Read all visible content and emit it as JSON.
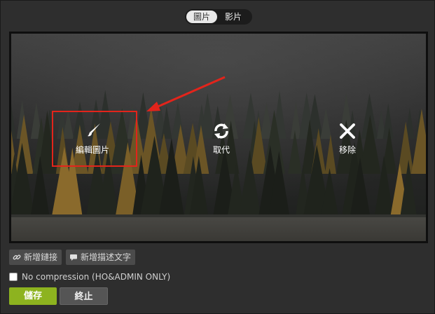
{
  "tabs": {
    "image": "圖片",
    "video": "影片"
  },
  "actions": {
    "edit": "編輯圖片",
    "replace": "取代",
    "remove": "移除"
  },
  "toolbar": {
    "add_link": "新增鏈接",
    "add_caption": "新增描述文字"
  },
  "compression": {
    "label": "No compression (HO&ADMIN ONLY)",
    "checked": false
  },
  "buttons": {
    "save": "儲存",
    "cancel": "終止"
  },
  "colors": {
    "save_green": "#8db31f",
    "highlight_red": "#e3241b"
  },
  "icons": [
    "toggle",
    "brush-icon",
    "refresh-icon",
    "close-icon",
    "link-icon",
    "comment-icon"
  ]
}
